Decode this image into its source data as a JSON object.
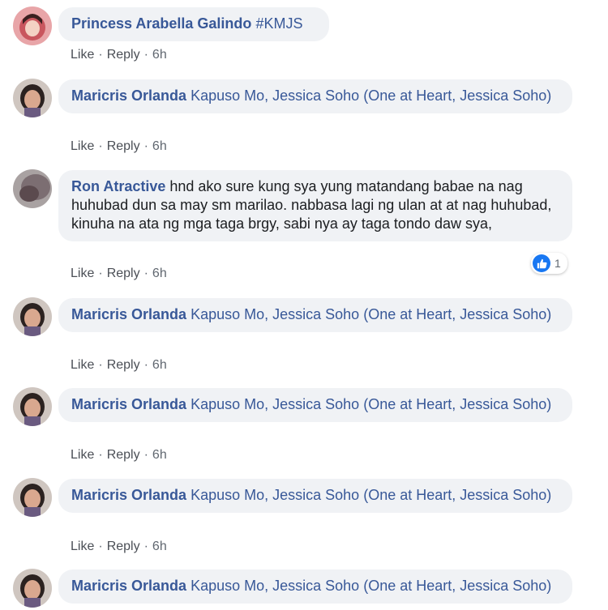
{
  "colors": {
    "author": "#385898",
    "bubble_bg": "#f0f2f5",
    "text": "#1c1e21",
    "actions": "#606770",
    "like_blue": "#1877f2"
  },
  "comments": [
    {
      "author": "Princess Arabella Galindo",
      "text_parts": [
        {
          "text": "#KMJS",
          "type": "tag"
        }
      ],
      "actions": {
        "like": "Like",
        "reply": "Reply",
        "time": "6h"
      },
      "avatar_icon": "avatar-pink-icon"
    },
    {
      "author": "Maricris Orlanda",
      "text_parts": [
        {
          "text": "Kapuso Mo, Jessica Soho (One at Heart, Jessica Soho)",
          "type": "mention"
        }
      ],
      "actions": {
        "like": "Like",
        "reply": "Reply",
        "time": "6h"
      },
      "avatar_icon": "avatar-photo-icon"
    },
    {
      "author": "Ron Atractive",
      "text_parts": [
        {
          "text": "hnd ako sure kung sya yung matandang babae na nag huhubad dun sa may sm marilao. nabbasa lagi ng ulan at at nag huhubad, kinuha na ata ng mga taga brgy, sabi nya ay taga tondo daw sya,",
          "type": "plain"
        }
      ],
      "actions": {
        "like": "Like",
        "reply": "Reply",
        "time": "6h"
      },
      "reaction": {
        "icon": "thumbs-up-icon",
        "count": "1"
      },
      "avatar_icon": "avatar-photo-icon"
    },
    {
      "author": "Maricris Orlanda",
      "text_parts": [
        {
          "text": "Kapuso Mo, Jessica Soho (One at Heart, Jessica Soho)",
          "type": "mention"
        }
      ],
      "actions": {
        "like": "Like",
        "reply": "Reply",
        "time": "6h"
      },
      "avatar_icon": "avatar-photo-icon"
    },
    {
      "author": "Maricris Orlanda",
      "text_parts": [
        {
          "text": "Kapuso Mo, Jessica Soho (One at Heart, Jessica Soho)",
          "type": "mention"
        }
      ],
      "actions": {
        "like": "Like",
        "reply": "Reply",
        "time": "6h"
      },
      "avatar_icon": "avatar-photo-icon"
    },
    {
      "author": "Maricris Orlanda",
      "text_parts": [
        {
          "text": "Kapuso Mo, Jessica Soho (One at Heart, Jessica Soho)",
          "type": "mention"
        }
      ],
      "actions": {
        "like": "Like",
        "reply": "Reply",
        "time": "6h"
      },
      "avatar_icon": "avatar-photo-icon"
    },
    {
      "author": "Maricris Orlanda",
      "text_parts": [
        {
          "text": "Kapuso Mo, Jessica Soho (One at Heart, Jessica Soho)",
          "type": "mention"
        }
      ],
      "avatar_icon": "avatar-photo-icon"
    }
  ]
}
